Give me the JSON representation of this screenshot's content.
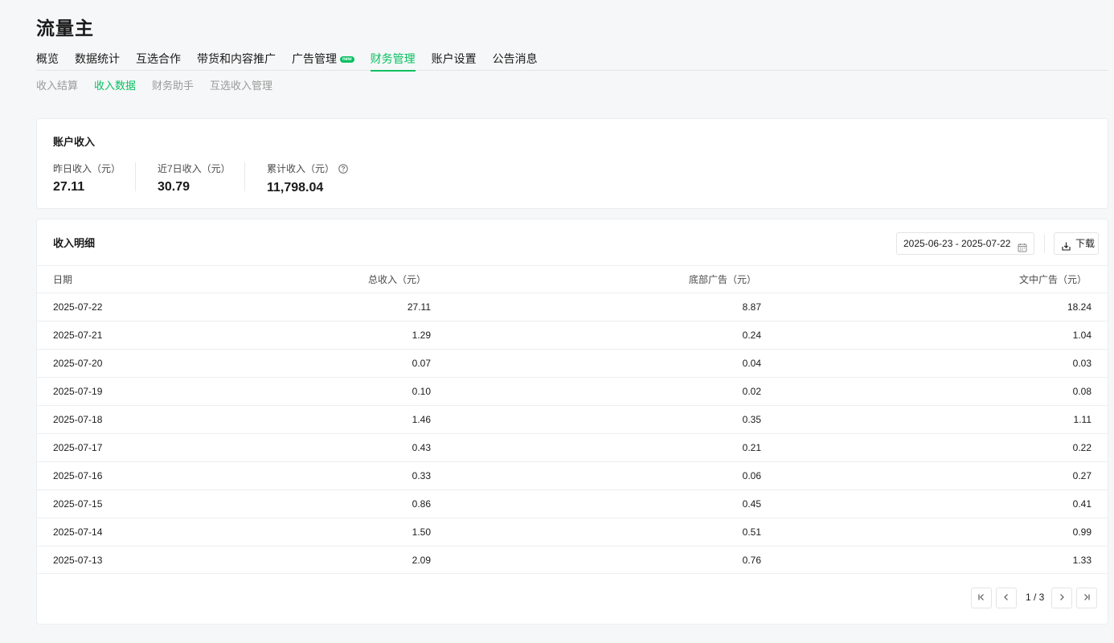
{
  "page": {
    "title": "流量主"
  },
  "main_nav": [
    {
      "label": "概览"
    },
    {
      "label": "数据统计"
    },
    {
      "label": "互选合作"
    },
    {
      "label": "带货和内容推广"
    },
    {
      "label": "广告管理",
      "badge": "new"
    },
    {
      "label": "财务管理",
      "active": true
    },
    {
      "label": "账户设置"
    },
    {
      "label": "公告消息"
    }
  ],
  "sub_nav": [
    {
      "label": "收入结算"
    },
    {
      "label": "收入数据",
      "active": true
    },
    {
      "label": "财务助手"
    },
    {
      "label": "互选收入管理"
    }
  ],
  "account_income": {
    "title": "账户收入",
    "yesterday": {
      "label": "昨日收入（元）",
      "value": "27.11"
    },
    "last7": {
      "label": "近7日收入（元）",
      "value": "30.79"
    },
    "total": {
      "label": "累计收入（元）",
      "value": "11,798.04"
    }
  },
  "income_detail": {
    "title": "收入明细",
    "date_range": "2025-06-23 - 2025-07-22",
    "download_label": "下载",
    "columns": [
      "日期",
      "总收入（元）",
      "底部广告（元）",
      "文中广告（元）"
    ],
    "rows": [
      [
        "2025-07-22",
        "27.11",
        "8.87",
        "18.24"
      ],
      [
        "2025-07-21",
        "1.29",
        "0.24",
        "1.04"
      ],
      [
        "2025-07-20",
        "0.07",
        "0.04",
        "0.03"
      ],
      [
        "2025-07-19",
        "0.10",
        "0.02",
        "0.08"
      ],
      [
        "2025-07-18",
        "1.46",
        "0.35",
        "1.11"
      ],
      [
        "2025-07-17",
        "0.43",
        "0.21",
        "0.22"
      ],
      [
        "2025-07-16",
        "0.33",
        "0.06",
        "0.27"
      ],
      [
        "2025-07-15",
        "0.86",
        "0.45",
        "0.41"
      ],
      [
        "2025-07-14",
        "1.50",
        "0.51",
        "0.99"
      ],
      [
        "2025-07-13",
        "2.09",
        "0.76",
        "1.33"
      ]
    ],
    "pagination": {
      "text": "1 / 3"
    }
  },
  "colors": {
    "accent": "#07c160",
    "background": "#f6f7f8",
    "card": "#ffffff"
  }
}
